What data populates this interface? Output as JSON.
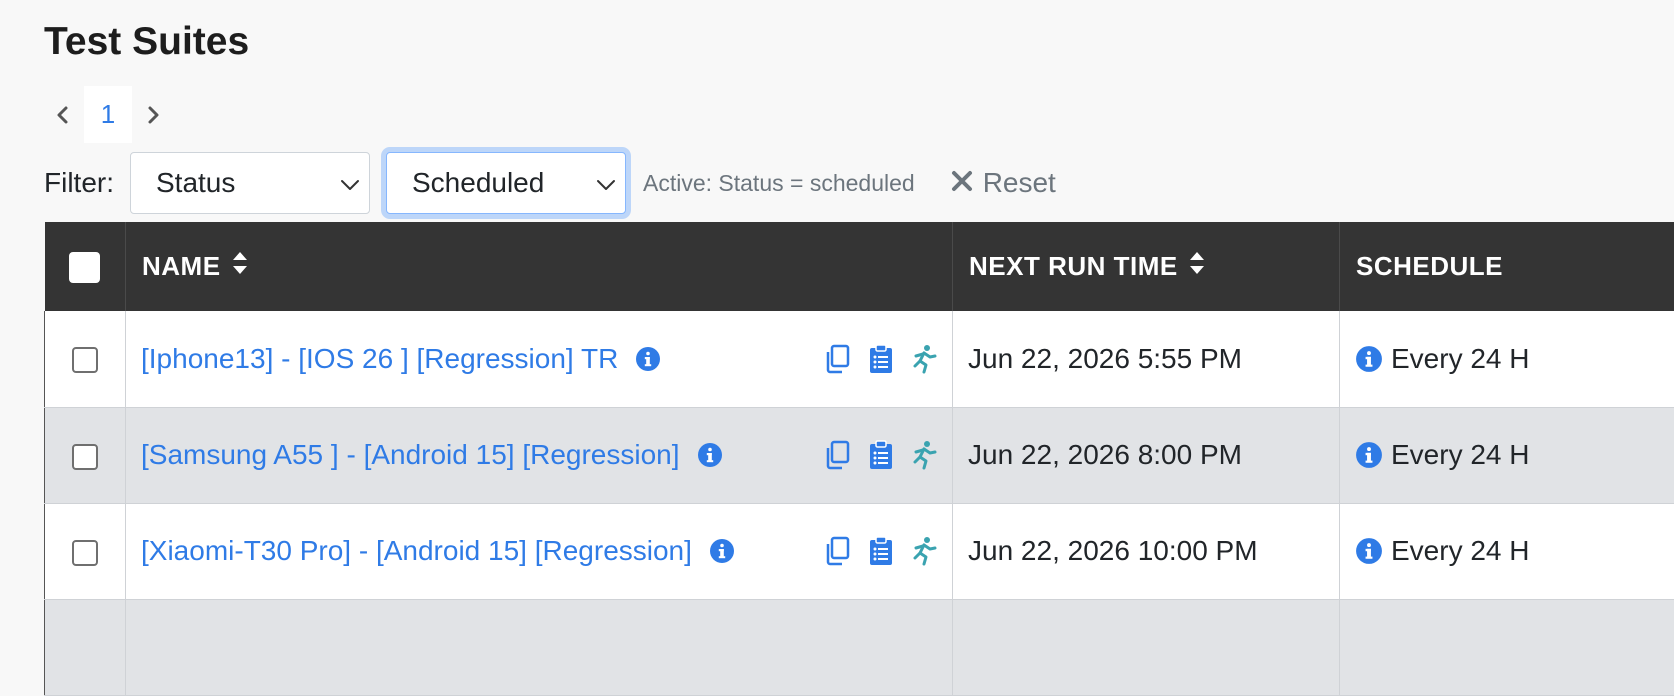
{
  "page": {
    "title": "Test Suites"
  },
  "pagination": {
    "current_page": "1"
  },
  "filter": {
    "label": "Filter:",
    "field_select": "Status",
    "value_select": "Scheduled",
    "active_text": "Active: Status = scheduled",
    "reset_label": "Reset"
  },
  "table": {
    "columns": {
      "name": "NAME",
      "next_run": "NEXT RUN TIME",
      "schedule": "SCHEDULE"
    },
    "rows": [
      {
        "name": "[Iphone13] - [IOS 26 ] [Regression] TR",
        "next_run": "Jun 22, 2026 5:55 PM",
        "schedule": "Every 24 H"
      },
      {
        "name": "[Samsung A55 ] - [Android 15] [Regression]",
        "next_run": "Jun 22, 2026 8:00 PM",
        "schedule": "Every 24 H"
      },
      {
        "name": "[Xiaomi-T30 Pro] - [Android 15] [Regression]",
        "next_run": "Jun 22, 2026 10:00 PM",
        "schedule": "Every 24 H"
      }
    ]
  },
  "icons": {
    "info": "info-circle-icon",
    "copy": "copy-icon",
    "clipboard": "clipboard-list-icon",
    "run": "running-person-icon",
    "sort": "sort-icon",
    "reset": "x-icon"
  },
  "colors": {
    "link": "#2f7be6",
    "header_bg": "#343434",
    "run_icon": "#3aa3b0",
    "row_alt": "#e1e3e6"
  }
}
